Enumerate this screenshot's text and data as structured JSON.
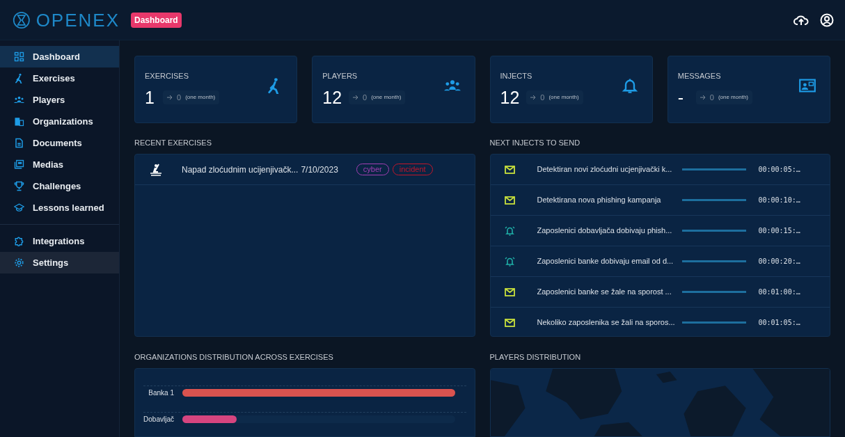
{
  "logo": {
    "text": "OPENEX"
  },
  "breadcrumb": {
    "label": "Dashboard"
  },
  "sidebar": {
    "groups": [
      {
        "items": [
          {
            "label": "Dashboard",
            "kind": "grid",
            "selected": true,
            "hovered": false
          },
          {
            "label": "Exercises",
            "kind": "runner",
            "selected": false,
            "hovered": false
          },
          {
            "label": "Players",
            "kind": "group",
            "selected": false,
            "hovered": false
          },
          {
            "label": "Organizations",
            "kind": "building",
            "selected": false,
            "hovered": false
          },
          {
            "label": "Documents",
            "kind": "doc",
            "selected": false,
            "hovered": false
          },
          {
            "label": "Medias",
            "kind": "media",
            "selected": false,
            "hovered": false
          },
          {
            "label": "Challenges",
            "kind": "trophy",
            "selected": false,
            "hovered": false
          },
          {
            "label": "Lessons learned",
            "kind": "cap",
            "selected": false,
            "hovered": false
          }
        ]
      },
      {
        "items": [
          {
            "label": "Integrations",
            "kind": "puzzle",
            "selected": false,
            "hovered": false
          },
          {
            "label": "Settings",
            "kind": "gear",
            "selected": false,
            "hovered": true
          }
        ]
      }
    ]
  },
  "stats": [
    {
      "title": "EXERCISES",
      "value": "1",
      "delta": "0",
      "period": "(one month)",
      "kind": "runner"
    },
    {
      "title": "PLAYERS",
      "value": "12",
      "delta": "0",
      "period": "(one month)",
      "kind": "group"
    },
    {
      "title": "INJECTS",
      "value": "12",
      "delta": "0",
      "period": "(one month)",
      "kind": "bell"
    },
    {
      "title": "MESSAGES",
      "value": "-",
      "delta": "0",
      "period": "(one month)",
      "kind": "contact"
    }
  ],
  "recent_exercises": {
    "title": "RECENT EXERCISES",
    "rows": [
      {
        "name": "Napad zloćudnim ucijenjivačk...",
        "date": "7/10/2023",
        "tags": [
          {
            "label": "cyber",
            "color": "#a43fb4"
          },
          {
            "label": "incident",
            "color": "#c4162a"
          }
        ]
      }
    ]
  },
  "next_injects": {
    "title": "NEXT INJECTS TO SEND",
    "rows": [
      {
        "kind": "mail",
        "title": "Detektiran novi zloćudni ucjenjivački k...",
        "level": 1,
        "time": "00:00:05:…"
      },
      {
        "kind": "mail",
        "title": "Detektirana nova phishing kampanja",
        "level": 1,
        "time": "00:00:10:…"
      },
      {
        "kind": "alarm",
        "title": "Zaposlenici dobavljača dobivaju phish...",
        "level": 1,
        "time": "00:00:15:…"
      },
      {
        "kind": "alarm",
        "title": "Zaposlenici banke dobivaju email od d...",
        "level": 1,
        "time": "00:00:20:…"
      },
      {
        "kind": "mail",
        "title": "Zaposlenici banke se žale na sporost ...",
        "level": 1,
        "time": "00:01:00:…"
      },
      {
        "kind": "mail",
        "title": "Nekoliko zaposlenika se žali na sporos...",
        "level": 1,
        "time": "00:01:05:…"
      }
    ]
  },
  "organizations_distribution": {
    "title": "ORGANIZATIONS DISTRIBUTION ACROSS EXERCISES",
    "bars": [
      {
        "label": "Banka 1",
        "level": 1,
        "color": "#d9534f"
      },
      {
        "label": "Dobavljač",
        "level": 0.2,
        "color": "#d6457f"
      }
    ]
  },
  "players_distribution": {
    "title": "PLAYERS DISTRIBUTION",
    "kind": "picture"
  }
}
